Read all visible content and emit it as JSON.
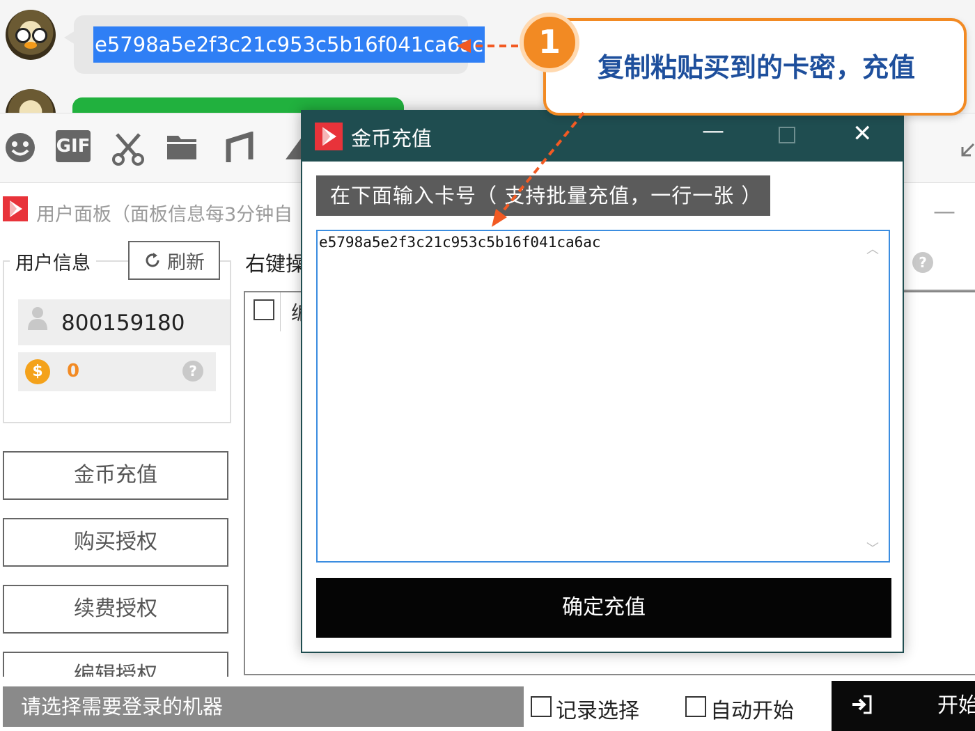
{
  "chat": {
    "message_text": "e5798a5e2f3c21c953c5b16f041ca6ac"
  },
  "callout": {
    "step_number": "1",
    "text": "复制粘贴买到的卡密，充值"
  },
  "toolbar": {
    "items": [
      "smile-icon",
      "gif-icon",
      "scissors-icon",
      "folder-icon",
      "music-icon",
      "image-icon"
    ],
    "gif_label": "GIF"
  },
  "panel": {
    "title": "用户面板（面板信息每3分钟自",
    "userinfo_label": "用户信息",
    "refresh_label": "刷新",
    "user_id": "800159180",
    "coin_value": "0",
    "help_symbol": "?",
    "buttons": [
      "金币充值",
      "购买授权",
      "续费授权",
      "编辑授权"
    ],
    "right_label": "右键操",
    "list_col_partial": "编",
    "minimize_symbol": "—"
  },
  "bottom": {
    "machine_select": "请选择需要登录的机器",
    "record_label": "记录选择",
    "auto_label": "自动开始",
    "start_label": "开始"
  },
  "dialog": {
    "title": "金币充值",
    "minimize_symbol": "—",
    "close_symbol": "✕",
    "hint": "在下面输入卡号（ 支持批量充值，一行一张 ）",
    "card_text": "e5798a5e2f3c21c953c5b16f041ca6ac",
    "confirm_label": "确定充值"
  },
  "colors": {
    "accent_orange": "#f28a23",
    "callout_text": "#1e4f9c",
    "dialog_titlebar": "#1f4d50",
    "selection_blue": "#2f7ff5"
  }
}
